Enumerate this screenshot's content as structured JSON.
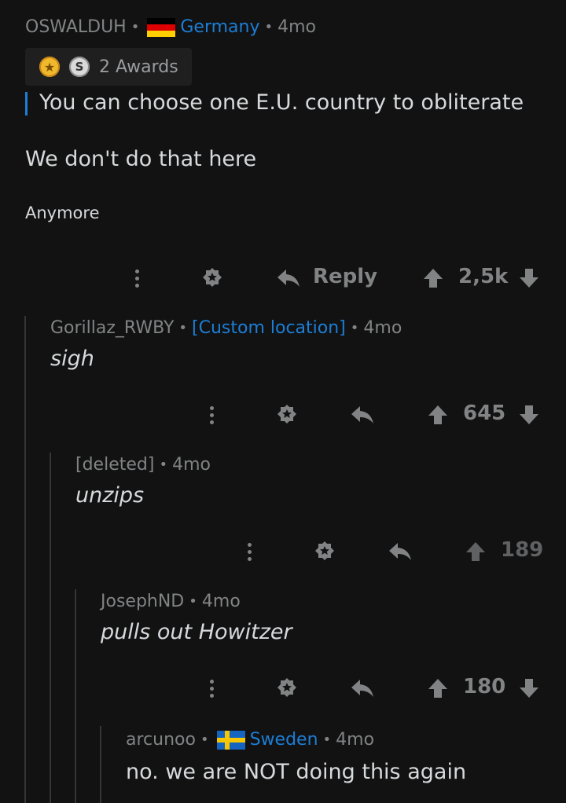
{
  "comments": [
    {
      "author": "OSWALDUH",
      "location": "Germany",
      "age": "4mo",
      "awards_label": "2 Awards",
      "quote": "You can choose one E.U. country to obliterate",
      "lines": [
        "We don't do that here",
        "Anymore"
      ],
      "reply_label": "Reply",
      "score": "2,5k"
    },
    {
      "author": "Gorillaz_RWBY",
      "location": "[Custom location]",
      "age": "4mo",
      "text": "sigh",
      "score": "645"
    },
    {
      "author": "[deleted]",
      "age": "4mo",
      "text": "unzips",
      "score": "189"
    },
    {
      "author": "JosephND",
      "age": "4mo",
      "text": "pulls out Howitzer",
      "score": "180"
    },
    {
      "author": "arcunoo",
      "location": "Sweden",
      "age": "4mo",
      "text": "no. we are NOT doing this again"
    }
  ],
  "colors": {
    "background": "#121212",
    "text": "#d7dadc",
    "muted": "#818384",
    "link": "#1c7ed6",
    "thread_line": "#343536"
  }
}
